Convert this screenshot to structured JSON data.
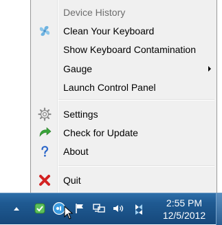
{
  "menu": {
    "items": [
      {
        "label": "Device History",
        "icon": "none",
        "disabled": true
      },
      {
        "label": "Clean Your Keyboard",
        "icon": "keyboard-fan-icon"
      },
      {
        "label": "Show Keyboard Contamination",
        "icon": "none"
      },
      {
        "label": "Gauge",
        "icon": "none",
        "submenu": true
      },
      {
        "label": "Launch Control Panel",
        "icon": "none"
      },
      {
        "label": "Settings",
        "icon": "gear-icon"
      },
      {
        "label": "Check for Update",
        "icon": "green-arrow-icon"
      },
      {
        "label": "About",
        "icon": "question-icon"
      },
      {
        "label": "Quit",
        "icon": "red-x-icon"
      }
    ]
  },
  "taskbar": {
    "time": "2:55 PM",
    "date": "12/5/2012",
    "tray_icons": [
      "show-hidden-icons-arrow",
      "security-shield-icon",
      "app-tray-icon",
      "action-center-flag-icon",
      "network-icon",
      "volume-icon",
      "bluetooth-icon"
    ]
  },
  "colors": {
    "menu_bg": "#f0f0f0",
    "taskbar": "#1f5a92",
    "quit_x": "#d32222",
    "update_arrow": "#3aa63a",
    "about_question": "#2a66c9"
  }
}
